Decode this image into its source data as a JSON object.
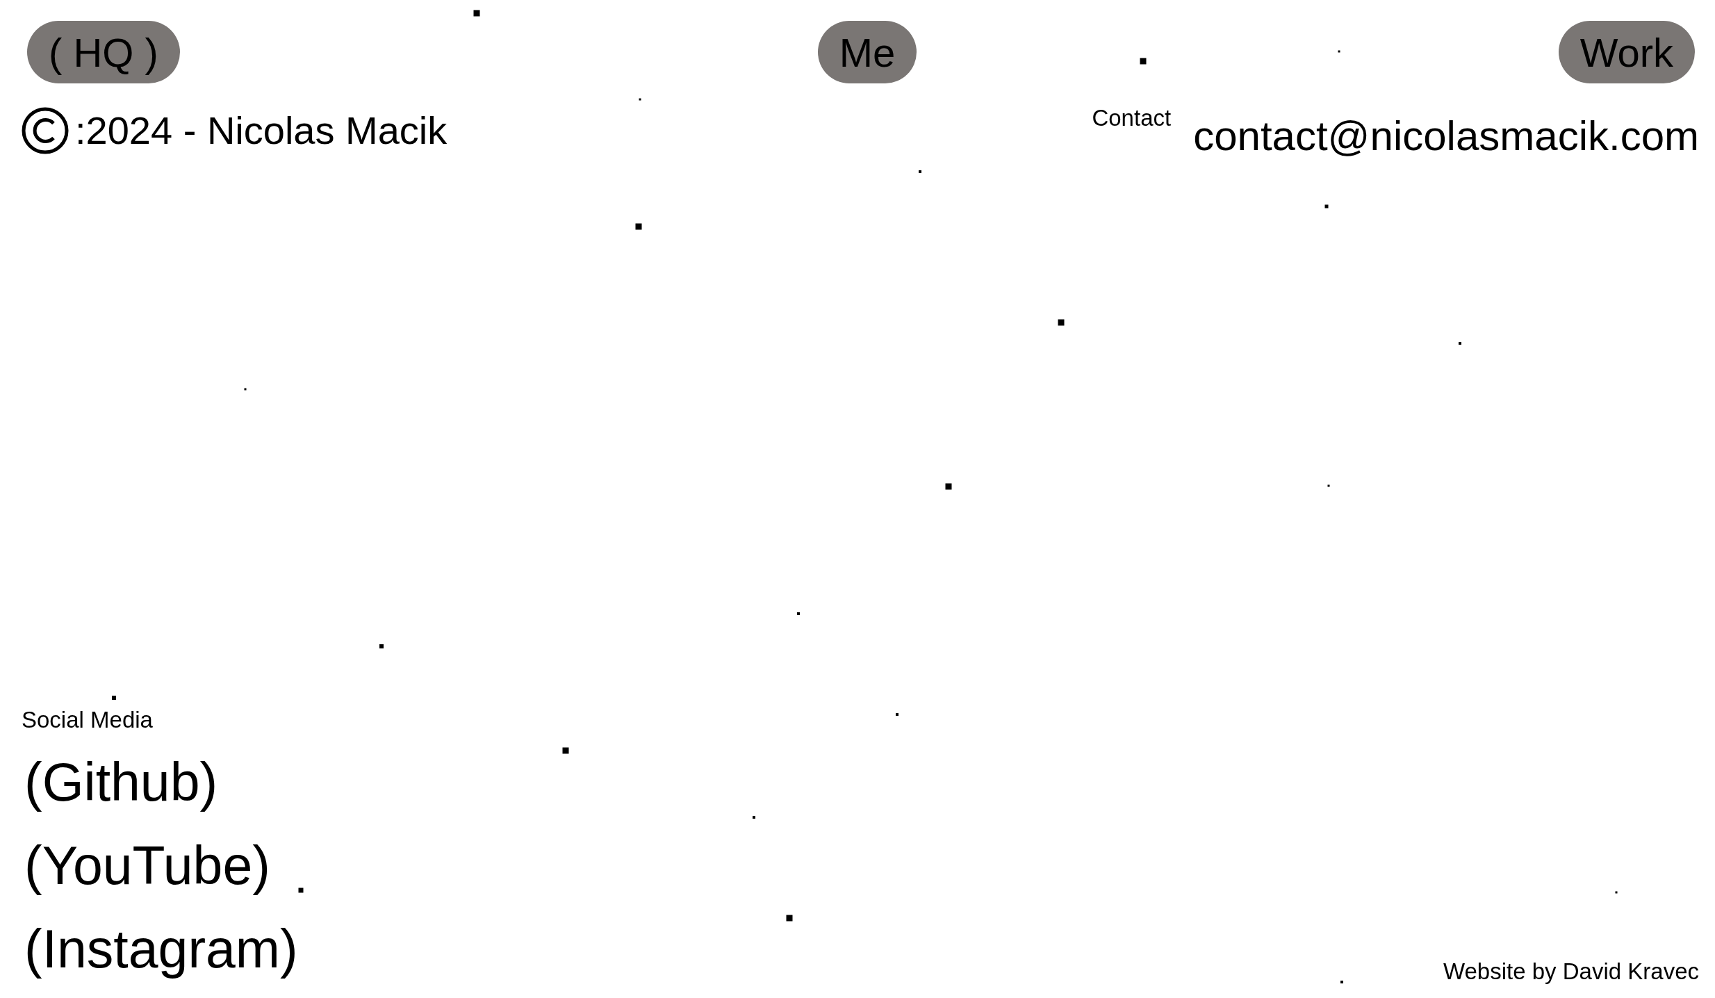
{
  "nav": [
    {
      "label": "( HQ )"
    },
    {
      "label": "Me"
    },
    {
      "label": "Work"
    }
  ],
  "copyright": {
    "text": ":2024 - Nicolas Macik"
  },
  "contact": {
    "label": "Contact",
    "email": "contact@nicolasmacik.com"
  },
  "social_media": {
    "label": "Social Media",
    "links": [
      "(Github)",
      "(YouTube)",
      "(Instagram)"
    ]
  },
  "credit": "Website by David Kravec"
}
